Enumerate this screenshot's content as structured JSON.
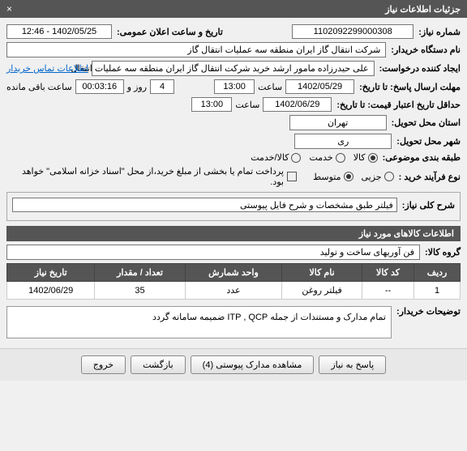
{
  "header": {
    "title": "جزئیات اطلاعات نیاز",
    "close": "×"
  },
  "form": {
    "need_no_label": "شماره نیاز:",
    "need_no": "1102092299000308",
    "announce_label": "تاریخ و ساعت اعلان عمومی:",
    "announce_value": "1402/05/25 - 12:46",
    "buyer_label": "نام دستگاه خریدار:",
    "buyer_value": "شرکت انتقال گاز ایران منطقه سه عملیات انتقال گاز",
    "creator_label": "ایجاد کننده درخواست:",
    "creator_value": "علی حیدرزاده مامور ارشد خرید شرکت انتقال گاز ایران منطقه سه عملیات انتقال",
    "contact_link": "اطلاعات تماس خریدار",
    "deadline_label": "مهلت ارسال پاسخ: تا تاریخ:",
    "deadline_date": "1402/05/29",
    "time_label": "ساعت",
    "deadline_time": "13:00",
    "days_label": "روز و",
    "days_value": "4",
    "remaining_time": "00:03:16",
    "remaining_label": "ساعت باقی مانده",
    "validity_label": "حداقل تاریخ اعتبار قیمت: تا تاریخ:",
    "validity_date": "1402/06/29",
    "validity_time": "13:00",
    "province_label": "استان محل تحویل:",
    "province_value": "تهران",
    "city_label": "شهر محل تحویل:",
    "city_value": "ری",
    "subject_class_label": "طبقه بندی موضوعی:",
    "option_goods": "کالا",
    "option_service": "خدمت",
    "option_goods_service": "کالا/خدمت",
    "purchase_type_label": "نوع فرآیند خرید :",
    "option_partial": "جزیی",
    "option_medium": "متوسط",
    "payment_note": "پرداخت تمام یا بخشی از مبلغ خرید،از محل \"اسناد خزانه اسلامی\" خواهد بود.",
    "general_desc_label": "شرح کلی نیاز:",
    "general_desc_value": "فیلتر طبق مشخصات و شرح فایل پیوستی",
    "goods_info_title": "اطلاعات کالاهای مورد نیاز",
    "goods_group_label": "گروه کالا:",
    "goods_group_value": "فن آوریهای ساخت و تولید",
    "buyer_notes_label": "توضیحات خریدار:",
    "buyer_notes_value": "تمام مدارک و مستندات از جمله ITP , QCP ضمیمه سامانه گردد"
  },
  "table": {
    "headers": {
      "row": "ردیف",
      "code": "کد کالا",
      "name": "نام کالا",
      "unit": "واحد شمارش",
      "qty": "تعداد / مقدار",
      "date": "تاریخ نیاز"
    },
    "rows": [
      {
        "row": "1",
        "code": "--",
        "name": "فیلتر روغن",
        "unit": "عدد",
        "qty": "35",
        "date": "1402/06/29"
      }
    ]
  },
  "buttons": {
    "respond": "پاسخ به نیاز",
    "attachments": "مشاهده مدارک پیوستی (4)",
    "back": "بازگشت",
    "exit": "خروج"
  }
}
